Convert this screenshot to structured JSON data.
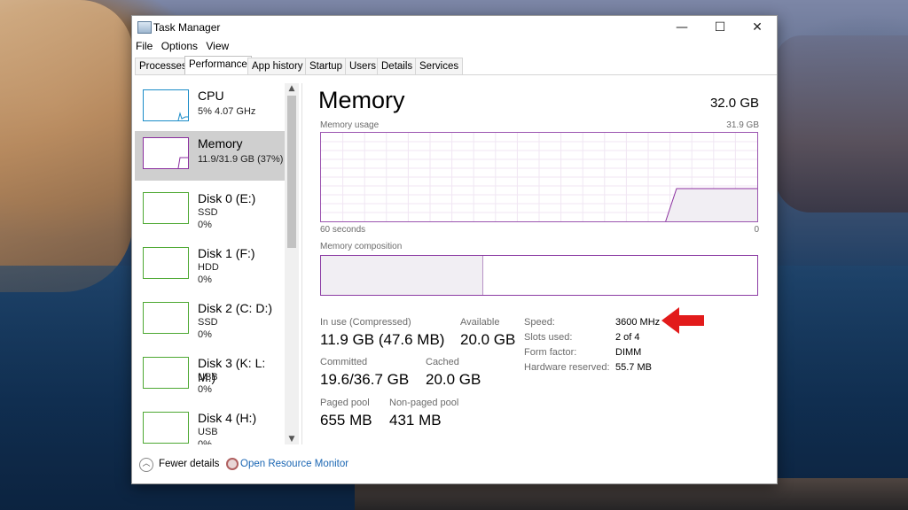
{
  "window": {
    "title": "Task Manager",
    "controls": [
      "—",
      "☐",
      "✕"
    ]
  },
  "menu": [
    "File",
    "Options",
    "View"
  ],
  "tabs": [
    "Processes",
    "Performance",
    "App history",
    "Startup",
    "Users",
    "Details",
    "Services"
  ],
  "active_tab": "Performance",
  "sidebar": {
    "items": [
      {
        "name": "CPU",
        "sub1": "5%  4.07 GHz",
        "sub2": "",
        "graph_color": "#1a8cc8"
      },
      {
        "name": "Memory",
        "sub1": "11.9/31.9 GB (37%)",
        "sub2": "",
        "graph_color": "#8b2f9f"
      },
      {
        "name": "Disk 0 (E:)",
        "sub1": "SSD",
        "sub2": "0%",
        "graph_color": "#4da832"
      },
      {
        "name": "Disk 1 (F:)",
        "sub1": "HDD",
        "sub2": "0%",
        "graph_color": "#4da832"
      },
      {
        "name": "Disk 2 (C: D:)",
        "sub1": "SSD",
        "sub2": "0%",
        "graph_color": "#4da832"
      },
      {
        "name": "Disk 3 (K: L: M:)",
        "sub1": "USB",
        "sub2": "0%",
        "graph_color": "#4da832"
      },
      {
        "name": "Disk 4 (H:)",
        "sub1": "USB",
        "sub2": "0%",
        "graph_color": "#4da832"
      }
    ],
    "selected": "Memory"
  },
  "main": {
    "title": "Memory",
    "total": "32.0 GB",
    "usage_label": "Memory usage",
    "usage_max": "31.9 GB",
    "time_left": "60 seconds",
    "time_right": "0",
    "composition_label": "Memory composition",
    "usage_fraction": 0.37,
    "composition_in_use_fraction": 0.37
  },
  "stats": {
    "in_use_label": "In use (Compressed)",
    "in_use_value": "11.9 GB (47.6 MB)",
    "available_label": "Available",
    "available_value": "20.0 GB",
    "committed_label": "Committed",
    "committed_value": "19.6/36.7 GB",
    "cached_label": "Cached",
    "cached_value": "20.0 GB",
    "paged_label": "Paged pool",
    "paged_value": "655 MB",
    "nonpaged_label": "Non-paged pool",
    "nonpaged_value": "431 MB"
  },
  "details": {
    "speed_label": "Speed:",
    "speed_value": "3600 MHz",
    "slots_label": "Slots used:",
    "slots_value": "2 of 4",
    "form_label": "Form factor:",
    "form_value": "DIMM",
    "reserved_label": "Hardware reserved:",
    "reserved_value": "55.7 MB"
  },
  "footer": {
    "fewer_details": "Fewer details",
    "resource_monitor": "Open Resource Monitor"
  },
  "colors": {
    "memory_accent": "#8b2f9f",
    "annotation_arrow": "#e21b1b",
    "link": "#1a66b3"
  }
}
